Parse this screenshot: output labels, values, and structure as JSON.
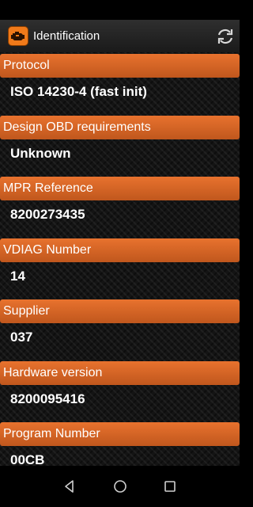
{
  "app": {
    "title": "Identification"
  },
  "sections": [
    {
      "label": "Protocol",
      "value": "ISO 14230-4 (fast init)"
    },
    {
      "label": "Design OBD requirements",
      "value": "Unknown"
    },
    {
      "label": "MPR Reference",
      "value": "8200273435"
    },
    {
      "label": "VDIAG Number",
      "value": "14"
    },
    {
      "label": "Supplier",
      "value": "037"
    },
    {
      "label": "Hardware version",
      "value": "8200095416"
    },
    {
      "label": "Program Number",
      "value": "00CB"
    }
  ],
  "icons": {
    "app": "engine-icon",
    "refresh": "refresh-icon",
    "back": "back-triangle-icon",
    "home": "home-circle-icon",
    "recents": "recents-square-icon"
  },
  "colors": {
    "accent": "#e8722e",
    "app_bar": "#2a2a2a",
    "background": "#141414"
  }
}
